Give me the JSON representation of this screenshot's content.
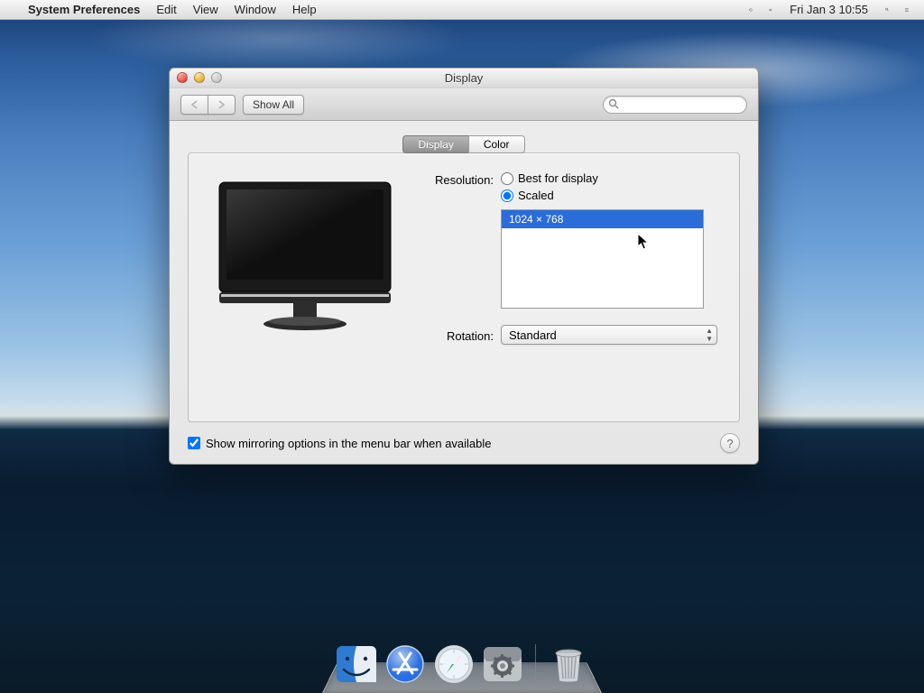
{
  "menubar": {
    "app": "System Preferences",
    "menus": {
      "edit": "Edit",
      "view": "View",
      "window": "Window",
      "help": "Help"
    },
    "clock": "Fri Jan 3  10:55"
  },
  "window": {
    "title": "Display",
    "toolbar": {
      "show_all": "Show All",
      "search_placeholder": ""
    },
    "tabs": {
      "display": "Display",
      "color": "Color"
    },
    "labels": {
      "resolution": "Resolution:",
      "best": "Best for display",
      "scaled": "Scaled",
      "rotation": "Rotation:"
    },
    "resolution_selected": "scaled",
    "scaled_options": [
      "1024 × 768"
    ],
    "scaled_selected_index": 0,
    "rotation_value": "Standard",
    "mirroring_label": "Show mirroring options in the menu bar when available",
    "mirroring_checked": true
  },
  "dock": {
    "items": [
      "finder",
      "app-store",
      "safari",
      "system-preferences",
      "trash"
    ]
  }
}
